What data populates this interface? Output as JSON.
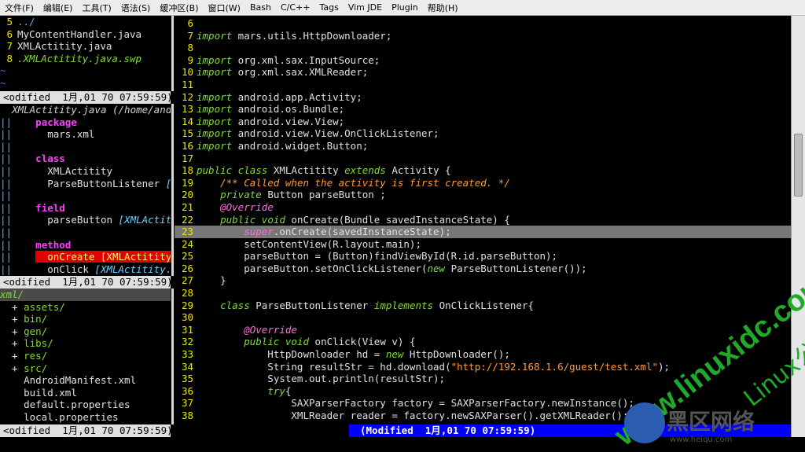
{
  "menubar": [
    "文件(F)",
    "编辑(E)",
    "工具(T)",
    "语法(S)",
    "缓冲区(B)",
    "窗口(W)",
    "Bash",
    "C/C++",
    "Tags",
    "Vim JDE",
    "Plugin",
    "帮助(H)"
  ],
  "files_pane": {
    "lines": [
      {
        "n": "5",
        "text": "../",
        "kind": "dir"
      },
      {
        "n": "6",
        "text": "MyContentHandler.java",
        "kind": "file"
      },
      {
        "n": "7",
        "text": "XMLActitity.java",
        "kind": "file"
      },
      {
        "n": "8",
        "text": ".XMLActitity.java.swp",
        "kind": "swp"
      }
    ],
    "tildes": [
      "~",
      "~"
    ],
    "status": "<odified  1月,01 70 07:59:59)"
  },
  "taglist_pane": {
    "header": "XMLActitity.java (/home/and",
    "lines": [
      {
        "prefix": "||",
        "text": "package",
        "kind": "section"
      },
      {
        "prefix": "||",
        "text": "mars.xml",
        "kind": "item"
      },
      {
        "prefix": "||",
        "text": "",
        "kind": "blank"
      },
      {
        "prefix": "||",
        "text": "class",
        "kind": "section"
      },
      {
        "prefix": "||",
        "text": "XMLActitity",
        "kind": "item"
      },
      {
        "prefix": "||",
        "text": "ParseButtonListener",
        "tag": "[XM",
        "kind": "item"
      },
      {
        "prefix": "||",
        "text": "",
        "kind": "blank"
      },
      {
        "prefix": "||",
        "text": "field",
        "kind": "section"
      },
      {
        "prefix": "||",
        "text": "parseButton",
        "tag": "[XMLActitit",
        "kind": "item"
      },
      {
        "prefix": "||",
        "text": "",
        "kind": "blank"
      },
      {
        "prefix": "||",
        "text": "method",
        "kind": "section"
      },
      {
        "prefix": "||",
        "text": "onCreate [XMLActitity]",
        "kind": "selected"
      },
      {
        "prefix": "||",
        "text": "onClick",
        "tag": "[XMLActitity.Pa",
        "kind": "item"
      }
    ],
    "status": "<odified  1月,01 70 07:59:59)"
  },
  "project_pane": {
    "root": "xml/",
    "items": [
      {
        "marker": "+",
        "text": "assets/",
        "kind": "folder"
      },
      {
        "marker": "+",
        "text": "bin/",
        "kind": "folder"
      },
      {
        "marker": "+",
        "text": "gen/",
        "kind": "folder"
      },
      {
        "marker": "+",
        "text": "libs/",
        "kind": "folder"
      },
      {
        "marker": "+",
        "text": "res/",
        "kind": "folder"
      },
      {
        "marker": "+",
        "text": "src/",
        "kind": "folder"
      },
      {
        "marker": "",
        "text": "AndroidManifest.xml",
        "kind": "file"
      },
      {
        "marker": "",
        "text": "build.xml",
        "kind": "file"
      },
      {
        "marker": "",
        "text": "default.properties",
        "kind": "file"
      },
      {
        "marker": "",
        "text": "local.properties",
        "kind": "file"
      }
    ],
    "status": "<odified  1月,01 70 07:59:59)"
  },
  "code": {
    "cursor_line": "23",
    "lines": [
      {
        "n": "6",
        "t": []
      },
      {
        "n": "7",
        "t": [
          [
            "kw",
            "import"
          ],
          [
            "p",
            " mars.utils.HttpDownloader;"
          ]
        ]
      },
      {
        "n": "8",
        "t": []
      },
      {
        "n": "9",
        "t": [
          [
            "kw",
            "import"
          ],
          [
            "p",
            " org.xml.sax.InputSource;"
          ]
        ]
      },
      {
        "n": "10",
        "t": [
          [
            "kw",
            "import"
          ],
          [
            "p",
            " org.xml.sax.XMLReader;"
          ]
        ]
      },
      {
        "n": "11",
        "t": []
      },
      {
        "n": "12",
        "t": [
          [
            "kw",
            "import"
          ],
          [
            "p",
            " android.app.Activity;"
          ]
        ]
      },
      {
        "n": "13",
        "t": [
          [
            "kw",
            "import"
          ],
          [
            "p",
            " android.os.Bundle;"
          ]
        ]
      },
      {
        "n": "14",
        "t": [
          [
            "kw",
            "import"
          ],
          [
            "p",
            " android.view.View;"
          ]
        ]
      },
      {
        "n": "15",
        "t": [
          [
            "kw",
            "import"
          ],
          [
            "p",
            " android.view.View.OnClickListener;"
          ]
        ]
      },
      {
        "n": "16",
        "t": [
          [
            "kw",
            "import"
          ],
          [
            "p",
            " android.widget.Button;"
          ]
        ]
      },
      {
        "n": "17",
        "t": []
      },
      {
        "n": "18",
        "t": [
          [
            "kw",
            "public class"
          ],
          [
            "p",
            " XMLActitity "
          ],
          [
            "kw",
            "extends"
          ],
          [
            "p",
            " Activity {"
          ]
        ]
      },
      {
        "n": "19",
        "t": [
          [
            "p",
            "    "
          ],
          [
            "cmt",
            "/** Called when the activity is first created. */"
          ]
        ]
      },
      {
        "n": "20",
        "t": [
          [
            "p",
            "    "
          ],
          [
            "kw",
            "private"
          ],
          [
            "p",
            " Button parseButton ;"
          ]
        ]
      },
      {
        "n": "21",
        "t": [
          [
            "p",
            "    "
          ],
          [
            "ann",
            "@Override"
          ]
        ]
      },
      {
        "n": "22",
        "t": [
          [
            "p",
            "    "
          ],
          [
            "kw",
            "public void"
          ],
          [
            "p",
            " onCreate(Bundle savedInstanceState) {"
          ]
        ]
      },
      {
        "n": "23",
        "t": [
          [
            "p",
            "        "
          ],
          [
            "ann",
            "super"
          ],
          [
            "p",
            ".onCreate(savedInstanceState);"
          ]
        ]
      },
      {
        "n": "24",
        "t": [
          [
            "p",
            "        setContentView(R.layout.main);"
          ]
        ]
      },
      {
        "n": "25",
        "t": [
          [
            "p",
            "        parseButton = (Button)findViewById(R.id.parseButton);"
          ]
        ]
      },
      {
        "n": "26",
        "t": [
          [
            "p",
            "        parseButton.setOnClickListener("
          ],
          [
            "kw",
            "new"
          ],
          [
            "p",
            " ParseButtonListener());"
          ]
        ]
      },
      {
        "n": "27",
        "t": [
          [
            "p",
            "    }"
          ]
        ]
      },
      {
        "n": "28",
        "t": []
      },
      {
        "n": "29",
        "t": [
          [
            "p",
            "    "
          ],
          [
            "kw",
            "class"
          ],
          [
            "p",
            " ParseButtonListener "
          ],
          [
            "kw",
            "implements"
          ],
          [
            "p",
            " OnClickListener{"
          ]
        ]
      },
      {
        "n": "30",
        "t": []
      },
      {
        "n": "31",
        "t": [
          [
            "p",
            "        "
          ],
          [
            "ann",
            "@Override"
          ]
        ]
      },
      {
        "n": "32",
        "t": [
          [
            "p",
            "        "
          ],
          [
            "kw",
            "public void"
          ],
          [
            "p",
            " onClick(View v) {"
          ]
        ]
      },
      {
        "n": "33",
        "t": [
          [
            "p",
            "            HttpDownloader hd = "
          ],
          [
            "kw",
            "new"
          ],
          [
            "p",
            " HttpDownloader();"
          ]
        ]
      },
      {
        "n": "34",
        "t": [
          [
            "p",
            "            String resultStr = hd.download("
          ],
          [
            "str",
            "\"http://192.168.1.6/guest/test.xml\""
          ],
          [
            "p",
            ");"
          ]
        ]
      },
      {
        "n": "35",
        "t": [
          [
            "p",
            "            System.out.println(resultStr);"
          ]
        ]
      },
      {
        "n": "36",
        "t": [
          [
            "p",
            "            "
          ],
          [
            "kw",
            "try"
          ],
          [
            "p",
            "{"
          ]
        ]
      },
      {
        "n": "37",
        "t": [
          [
            "p",
            "                SAXParserFactory factory = SAXParserFactory.newInstance();"
          ]
        ]
      },
      {
        "n": "38",
        "t": [
          [
            "p",
            "                XMLReader reader = factory.newSAXParser().getXMLReader();"
          ]
        ]
      }
    ],
    "status": "(Modified  1月,01 70 07:59:59)"
  },
  "watermark": {
    "site": "www.linuxidc.com",
    "brand": "Linux公社",
    "logo_text": "黑区网络",
    "logo_sub": "www.heiqu.com"
  },
  "colors": {
    "statusline_active": "#0000ff",
    "statusline_inactive": "#e0e0e0",
    "watermark_green": "#1faa2a"
  }
}
